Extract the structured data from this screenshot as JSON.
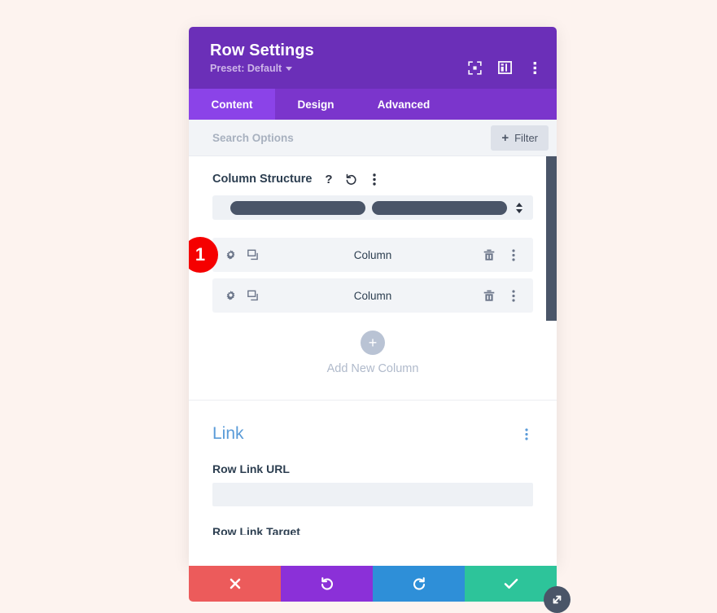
{
  "header": {
    "title": "Row Settings",
    "preset_label": "Preset: Default",
    "icons": {
      "focus": "focus-target-icon",
      "layout": "layout-panel-icon",
      "menu": "kebab-menu-icon"
    }
  },
  "tabs": [
    {
      "label": "Content",
      "active": true
    },
    {
      "label": "Design",
      "active": false
    },
    {
      "label": "Advanced",
      "active": false
    }
  ],
  "search": {
    "placeholder": "Search Options",
    "value": "",
    "filter_label": "Filter",
    "filter_plus": "+"
  },
  "column_structure": {
    "label": "Column Structure",
    "help_glyph": "?",
    "icons": [
      "help-icon",
      "reset-icon",
      "kebab-menu-icon"
    ],
    "bars": 2
  },
  "columns": [
    {
      "name": "Column",
      "badge": "1"
    },
    {
      "name": "Column",
      "badge": ""
    }
  ],
  "add_column": {
    "plus": "+",
    "label": "Add New Column"
  },
  "link": {
    "title": "Link",
    "fields": [
      {
        "label": "Row Link URL",
        "value": "",
        "placeholder": ""
      },
      {
        "label": "Row Link Target",
        "value": "",
        "placeholder": ""
      }
    ]
  },
  "footer": {
    "actions": [
      {
        "name": "cancel",
        "glyph": "✖"
      },
      {
        "name": "undo",
        "glyph": "↺"
      },
      {
        "name": "redo",
        "glyph": "↻"
      },
      {
        "name": "save",
        "glyph": "✔"
      }
    ]
  },
  "colors": {
    "header_purple": "#6b2fb8",
    "tab_bar_purple": "#7b35cc",
    "tab_active_purple": "#8b43e8",
    "badge_red": "#f50000",
    "cancel_red": "#ec5b5b",
    "undo_purple": "#8b30d8",
    "redo_blue": "#2e8fd8",
    "save_green": "#2dc49a",
    "link_blue": "#5a9bd8",
    "slate": "#4a5568",
    "page_background": "#fdf3ef"
  }
}
